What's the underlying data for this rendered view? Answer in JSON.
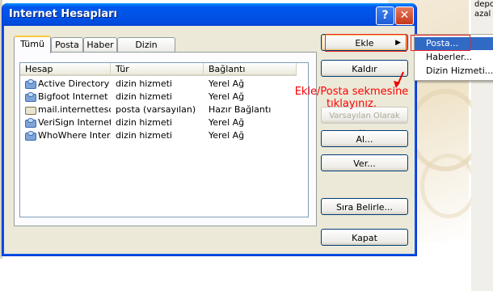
{
  "window": {
    "title": "Internet Hesapları",
    "help_label": "?",
    "close_label": "✕"
  },
  "tabs": [
    {
      "label": "Tümü",
      "active": true
    },
    {
      "label": "Posta",
      "active": false
    },
    {
      "label": "Haber",
      "active": false
    },
    {
      "label": "Dizin Hizmeti",
      "active": false
    }
  ],
  "list": {
    "columns": [
      "Hesap",
      "Tür",
      "Bağlantı"
    ],
    "rows": [
      {
        "account": "Active Directory",
        "type": "dizin hizmeti",
        "connection": "Yerel Ağ"
      },
      {
        "account": "Bigfoot Internet ...",
        "type": "dizin hizmeti",
        "connection": "Yerel Ağ"
      },
      {
        "account": "mail.internettescil...",
        "type": "posta (varsayılan)",
        "connection": "Hazır Bağlantı"
      },
      {
        "account": "VeriSign Internet ...",
        "type": "dizin hizmeti",
        "connection": "Yerel Ağ"
      },
      {
        "account": "WhoWhere Inter...",
        "type": "dizin hizmeti",
        "connection": "Yerel Ağ"
      }
    ]
  },
  "buttons": {
    "add": "Ekle",
    "remove": "Kaldır",
    "set_default": "Varsayılan Olarak Ata",
    "import": "Al...",
    "export": "Ver...",
    "set_order": "Sıra Belirle...",
    "close": "Kapat"
  },
  "menu": {
    "items": [
      "Posta...",
      "Haberler...",
      "Dizin Hizmeti..."
    ],
    "selected_index": 0
  },
  "annotation": {
    "text": "Ekle/Posta sekmesine tıklayınız."
  },
  "side_text": [
    "depo",
    "azal"
  ],
  "colors": {
    "annotation": "#ff0000",
    "title_bar": "#0054e3",
    "menu_selected": "#316ac5"
  }
}
